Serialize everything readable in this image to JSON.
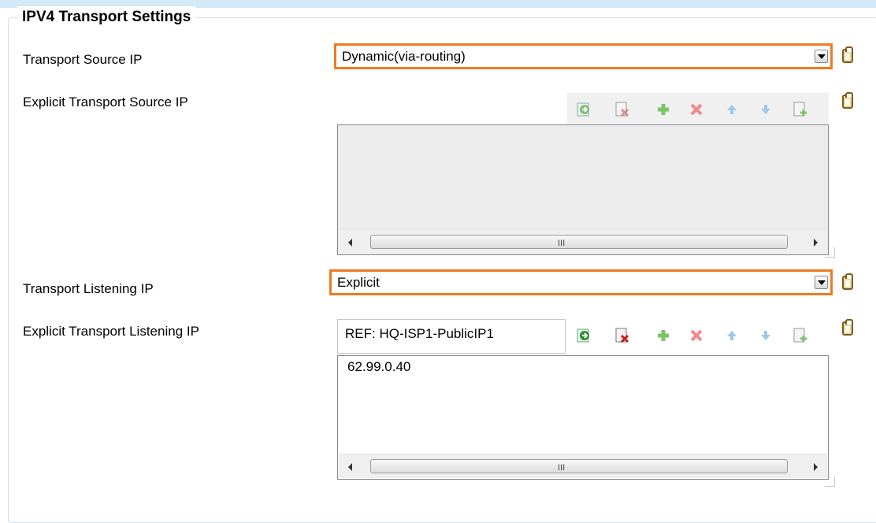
{
  "section": {
    "title": "IPV4 Transport Settings"
  },
  "fields": {
    "transport_source_ip": {
      "label": "Transport Source IP",
      "value": "Dynamic(via-routing)"
    },
    "explicit_transport_source_ip": {
      "label": "Explicit Transport Source IP",
      "items": []
    },
    "transport_listening_ip": {
      "label": "Transport Listening IP",
      "value": "Explicit"
    },
    "explicit_transport_listening_ip": {
      "label": "Explicit Transport Listening IP",
      "input_value": "REF: HQ-ISP1-PublicIP1",
      "items": [
        "62.99.0.40"
      ]
    }
  },
  "scrollbar_grip": "III",
  "icons": {
    "toolbar": [
      "go-to-reference-icon",
      "delete-list-icon",
      "add-icon",
      "remove-icon",
      "move-up-icon",
      "move-down-icon",
      "add-from-list-icon"
    ],
    "clipboard": "clipboard-icon",
    "dropdown": "chevron-down-icon"
  },
  "colors": {
    "combo_border": "#f07a22",
    "group_border": "#d5dfe5",
    "header_strip": "#d4e8f5"
  }
}
